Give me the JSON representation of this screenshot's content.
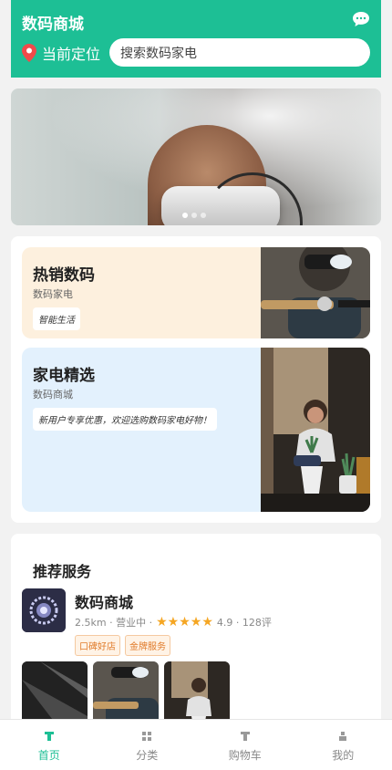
{
  "header": {
    "title": "数码商城",
    "location_label": "当前定位",
    "search_placeholder": "搜索数码家电",
    "brand_color": "#1dbf95",
    "icons": [
      "chat-icon",
      "location-pin-icon"
    ]
  },
  "banner": {
    "slides": 3,
    "active_slide": 1
  },
  "promos": [
    {
      "title": "热销数码",
      "subtitle": "数码家电",
      "tag": "智能生活",
      "background": "#fdf0de"
    },
    {
      "title": "家电精选",
      "subtitle": "数码商城",
      "tag": "新用户专享优惠，欢迎选购数码家电好物！",
      "background": "#e3f1fd"
    }
  ],
  "recommend": {
    "title": "推荐服务",
    "shop": {
      "name": "数码商城",
      "distance": "2.5km",
      "status": "营业中",
      "rating": "4.9",
      "rating_value": 4.9,
      "star_count": 5,
      "reviews": "128评",
      "badges": [
        "口碑好店",
        "金牌服务"
      ]
    }
  },
  "tabbar": {
    "items": [
      {
        "label": "首页",
        "icon": "home-icon",
        "active": true
      },
      {
        "label": "分类",
        "icon": "category-grid-icon",
        "active": false
      },
      {
        "label": "购物车",
        "icon": "cart-icon",
        "active": false
      },
      {
        "label": "我的",
        "icon": "user-icon",
        "active": false
      }
    ]
  }
}
